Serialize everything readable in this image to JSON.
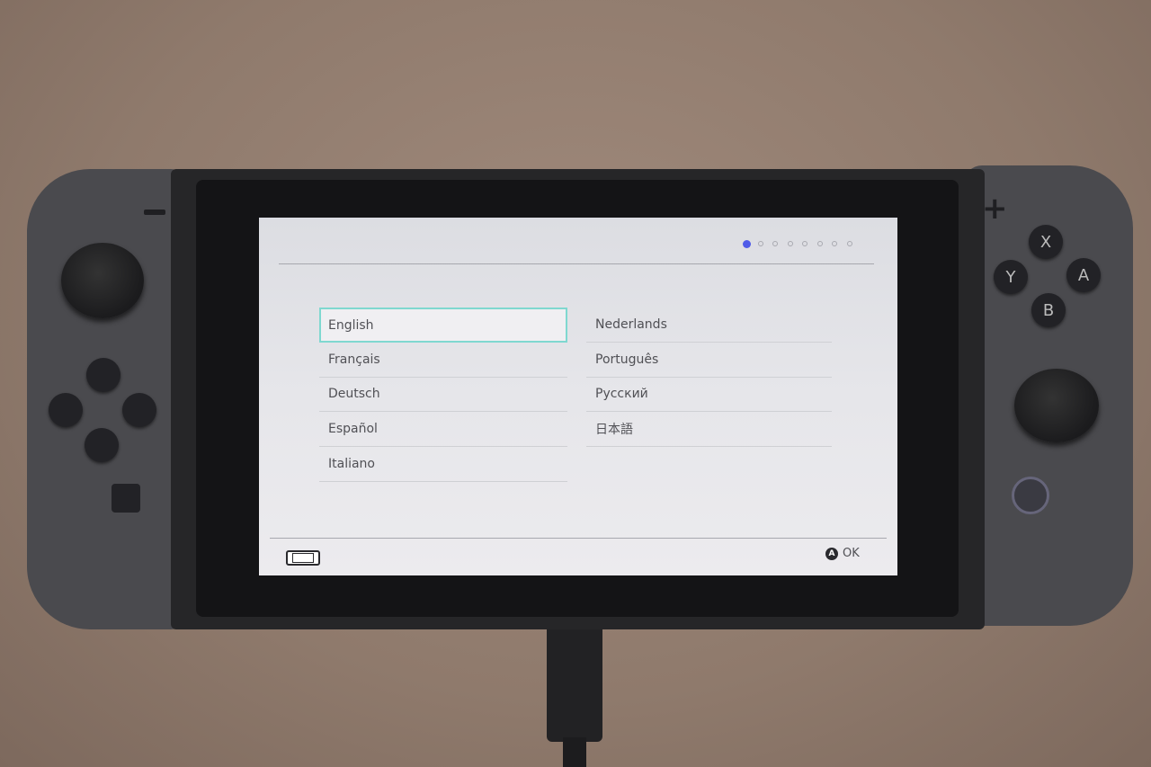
{
  "device": {
    "left_buttons": {
      "minus": "−"
    },
    "right_buttons": {
      "plus": "+",
      "x": "X",
      "y": "Y",
      "a": "A",
      "b": "B"
    }
  },
  "screen": {
    "progress": {
      "current_step": 1,
      "total_steps": 8,
      "active_color": "#4f5be8"
    },
    "languages_left": [
      "English",
      "Français",
      "Deutsch",
      "Español",
      "Italiano"
    ],
    "languages_right": [
      "Nederlands",
      "Português",
      "Русский",
      "日本語"
    ],
    "selected_language": "English",
    "selection_color": "#7fd8d0",
    "footer": {
      "controller_icon": "handheld-console-icon",
      "ok_button_glyph": "A",
      "ok_label": "OK"
    }
  }
}
